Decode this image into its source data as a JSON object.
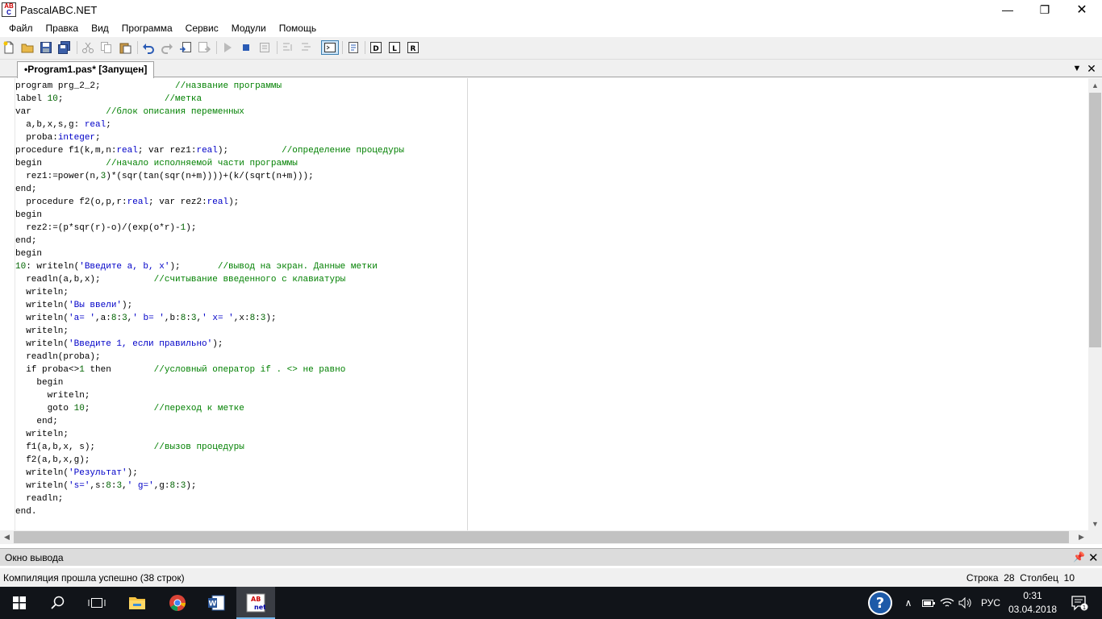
{
  "window": {
    "title": "PascalABC.NET"
  },
  "menu": [
    "Файл",
    "Правка",
    "Вид",
    "Программа",
    "Сервис",
    "Модули",
    "Помощь"
  ],
  "tab": {
    "label": "•Program1.pas* [Запущен]"
  },
  "code_lines": [
    [
      [
        "k",
        "program"
      ],
      [
        "t",
        " prg_2_2;              "
      ],
      [
        "c",
        "//название программы"
      ]
    ],
    [
      [
        "k",
        "label"
      ],
      [
        "t",
        " "
      ],
      [
        "n",
        "10"
      ],
      [
        "t",
        ";                   "
      ],
      [
        "c",
        "//метка"
      ]
    ],
    [
      [
        "k",
        "var"
      ],
      [
        "t",
        "              "
      ],
      [
        "c",
        "//блок описания переменных"
      ]
    ],
    [
      [
        "t",
        "  a,b,x,s,g: "
      ],
      [
        "y",
        "real"
      ],
      [
        "t",
        ";"
      ]
    ],
    [
      [
        "t",
        "  proba:"
      ],
      [
        "y",
        "integer"
      ],
      [
        "t",
        ";"
      ]
    ],
    [
      [
        "k",
        "procedure"
      ],
      [
        "t",
        " f1(k,m,n:"
      ],
      [
        "y",
        "real"
      ],
      [
        "t",
        "; "
      ],
      [
        "k",
        "var"
      ],
      [
        "t",
        " rez1:"
      ],
      [
        "y",
        "real"
      ],
      [
        "t",
        ");          "
      ],
      [
        "c",
        "//определение процедуры"
      ]
    ],
    [
      [
        "k",
        "begin"
      ],
      [
        "t",
        "            "
      ],
      [
        "c",
        "//начало исполняемой части программы"
      ]
    ],
    [
      [
        "t",
        "  rez1:=power(n,"
      ],
      [
        "n",
        "3"
      ],
      [
        "t",
        ")*(sqr(tan(sqr(n+m))))+(k/(sqrt(n+m)));"
      ]
    ],
    [
      [
        "k",
        "end"
      ],
      [
        "t",
        ";"
      ]
    ],
    [
      [
        "t",
        "  "
      ],
      [
        "k",
        "procedure"
      ],
      [
        "t",
        " f2(o,p,r:"
      ],
      [
        "y",
        "real"
      ],
      [
        "t",
        "; "
      ],
      [
        "k",
        "var"
      ],
      [
        "t",
        " rez2:"
      ],
      [
        "y",
        "real"
      ],
      [
        "t",
        ");"
      ]
    ],
    [
      [
        "k",
        "begin"
      ]
    ],
    [
      [
        "t",
        "  rez2:=(p*sqr(r)-o)/(exp(o*r)-"
      ],
      [
        "n",
        "1"
      ],
      [
        "t",
        ");"
      ]
    ],
    [
      [
        "k",
        "end"
      ],
      [
        "t",
        ";"
      ]
    ],
    [
      [
        "k",
        "begin"
      ]
    ],
    [
      [
        "n",
        "10"
      ],
      [
        "t",
        ": writeln("
      ],
      [
        "s",
        "'Введите a, b, x'"
      ],
      [
        "t",
        ");       "
      ],
      [
        "c",
        "//вывод на экран. Данные метки"
      ]
    ],
    [
      [
        "t",
        "  readln(a,b,x);          "
      ],
      [
        "c",
        "//считывание введенного с клавиатуры"
      ]
    ],
    [
      [
        "t",
        "  writeln;"
      ]
    ],
    [
      [
        "t",
        "  writeln("
      ],
      [
        "s",
        "'Вы ввели'"
      ],
      [
        "t",
        ");"
      ]
    ],
    [
      [
        "t",
        "  writeln("
      ],
      [
        "s",
        "'a= '"
      ],
      [
        "t",
        ",a:"
      ],
      [
        "n",
        "8"
      ],
      [
        "t",
        ":"
      ],
      [
        "n",
        "3"
      ],
      [
        "t",
        ","
      ],
      [
        "s",
        "' b= '"
      ],
      [
        "t",
        ",b:"
      ],
      [
        "n",
        "8"
      ],
      [
        "t",
        ":"
      ],
      [
        "n",
        "3"
      ],
      [
        "t",
        ","
      ],
      [
        "s",
        "' x= '"
      ],
      [
        "t",
        ",x:"
      ],
      [
        "n",
        "8"
      ],
      [
        "t",
        ":"
      ],
      [
        "n",
        "3"
      ],
      [
        "t",
        ");"
      ]
    ],
    [
      [
        "t",
        "  writeln;"
      ]
    ],
    [
      [
        "t",
        "  writeln("
      ],
      [
        "s",
        "'Введите 1, если правильно'"
      ],
      [
        "t",
        ");"
      ]
    ],
    [
      [
        "t",
        "  readln(proba);"
      ]
    ],
    [
      [
        "t",
        "  "
      ],
      [
        "k",
        "if"
      ],
      [
        "t",
        " proba<>"
      ],
      [
        "n",
        "1"
      ],
      [
        "t",
        " "
      ],
      [
        "k",
        "then"
      ],
      [
        "t",
        "        "
      ],
      [
        "c",
        "//условный оператор if . <> не равно"
      ]
    ],
    [
      [
        "t",
        "    "
      ],
      [
        "k",
        "begin"
      ]
    ],
    [
      [
        "t",
        "      writeln;"
      ]
    ],
    [
      [
        "t",
        "      "
      ],
      [
        "k",
        "goto"
      ],
      [
        "t",
        " "
      ],
      [
        "n",
        "10"
      ],
      [
        "t",
        ";            "
      ],
      [
        "c",
        "//переход к метке"
      ]
    ],
    [
      [
        "t",
        "    "
      ],
      [
        "k",
        "end"
      ],
      [
        "t",
        ";"
      ]
    ],
    [
      [
        "t",
        "  writeln;"
      ]
    ],
    [
      [
        "t",
        "  f1(a,b,x, s);           "
      ],
      [
        "c",
        "//вызов процедуры"
      ]
    ],
    [
      [
        "t",
        "  f2(a,b,x,g);"
      ]
    ],
    [
      [
        "t",
        "  writeln("
      ],
      [
        "s",
        "'Результат'"
      ],
      [
        "t",
        ");"
      ]
    ],
    [
      [
        "t",
        "  writeln("
      ],
      [
        "s",
        "'s='"
      ],
      [
        "t",
        ",s:"
      ],
      [
        "n",
        "8"
      ],
      [
        "t",
        ":"
      ],
      [
        "n",
        "3"
      ],
      [
        "t",
        ","
      ],
      [
        "s",
        "' g='"
      ],
      [
        "t",
        ",g:"
      ],
      [
        "n",
        "8"
      ],
      [
        "t",
        ":"
      ],
      [
        "n",
        "3"
      ],
      [
        "t",
        ");"
      ]
    ],
    [
      [
        "t",
        "  readln;"
      ]
    ],
    [
      [
        "k",
        "end"
      ],
      [
        "t",
        "."
      ]
    ]
  ],
  "output_panel": {
    "title": "Окно вывода"
  },
  "status": {
    "message": "Компиляция прошла успешно (38 строк)",
    "line_label": "Строка",
    "line_value": "28",
    "col_label": "Столбец",
    "col_value": "10"
  },
  "taskbar": {
    "lang": "РУС",
    "time": "0:31",
    "date": "03.04.2018",
    "notification_count": "1",
    "apps": [
      "start-button",
      "search",
      "task-view",
      "file-explorer",
      "chrome",
      "word",
      "pascalabc"
    ]
  },
  "colors": {
    "comment": "#008000",
    "string": "#0000c8",
    "number": "#006400",
    "taskbar": "#111419"
  }
}
